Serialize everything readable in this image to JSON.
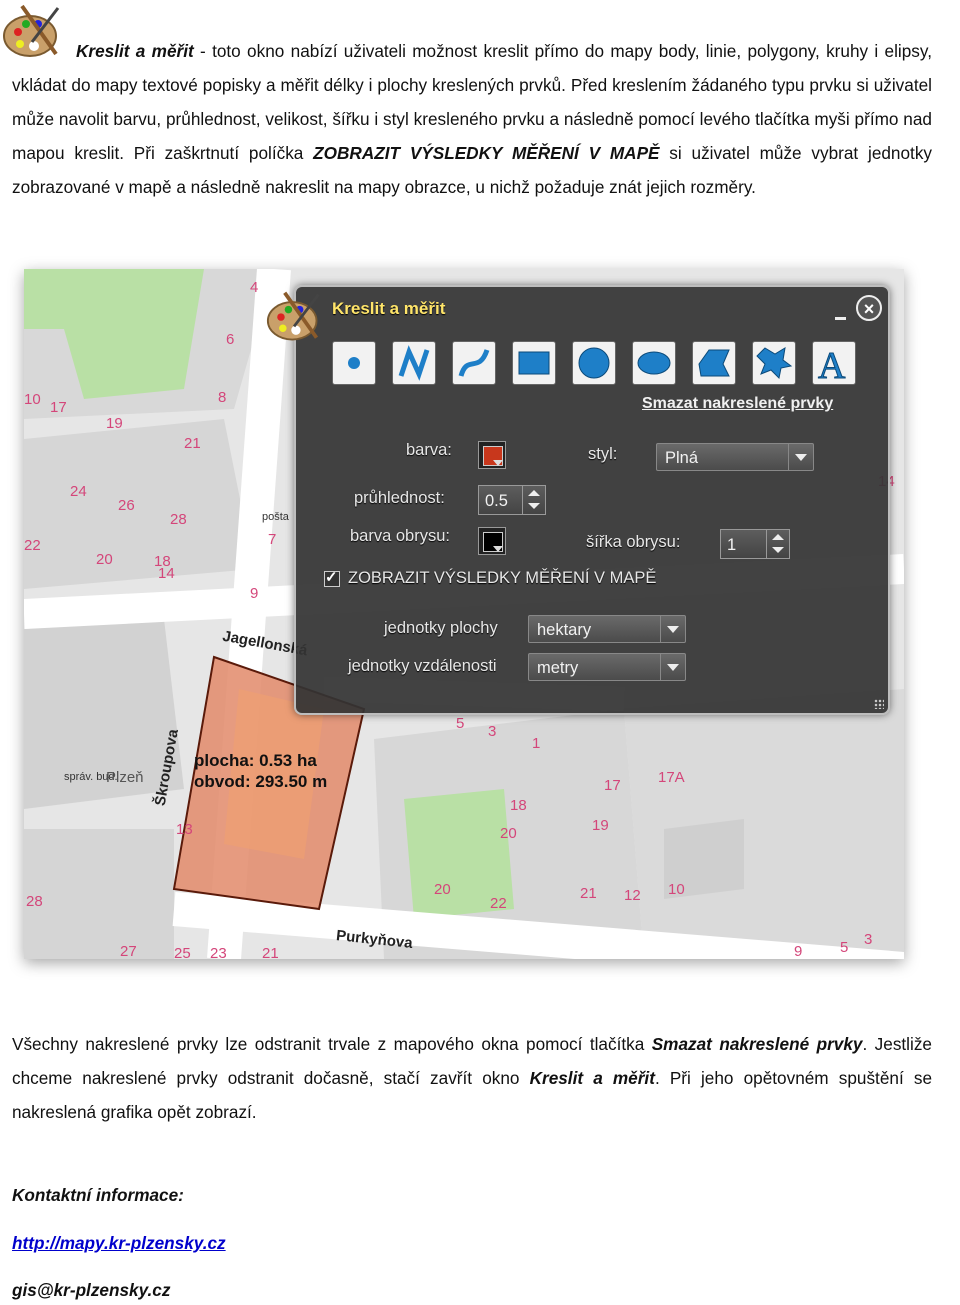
{
  "intro": {
    "title": "Kreslit a měřit",
    "part1": " - toto okno nabízí uživateli možnost kreslit přímo do mapy body, linie, polygony, kruhy i elipsy, vkládat do mapy textové popisky a měřit délky i plochy kreslených prvků. Před kreslením žádaného typu prvku si uživatel může navolit barvu, průhlednost, velikost, šířku i styl kresleného prvku a následně pomocí levého tlačítka myši přímo nad mapou kreslit. Při zaškrtnutí políčka ",
    "emph": "ZOBRAZIT VÝSLEDKY MĚŘENÍ V MAPĚ",
    "part2": " si uživatel může vybrat jednotky zobrazované v mapě a následně nakreslit na mapy obrazce, u nichž požaduje znát jejich rozměry."
  },
  "dialog": {
    "title": "Kreslit a měřit",
    "tools": [
      "point-tool-icon",
      "line-tool-icon",
      "curve-tool-icon",
      "rectangle-tool-icon",
      "circle-tool-icon",
      "ellipse-tool-icon",
      "polygon-tool-icon",
      "freehand-tool-icon",
      "text-tool-icon"
    ],
    "text_tool_glyph": "A",
    "clear_label": "Smazat nakreslené prvky",
    "color_label": "barva:",
    "color_value": "#c8371c",
    "style_label": "styl:",
    "style_value": "Plná",
    "opacity_label": "průhlednost:",
    "opacity_value": "0.5",
    "outline_color_label": "barva obrysu:",
    "outline_color_value": "#000000",
    "outline_width_label": "šířka obrysu:",
    "outline_width_value": "1",
    "show_results_label": "ZOBRAZIT VÝSLEDKY MĚŘENÍ V MAPĚ",
    "area_units_label": "jednotky plochy",
    "area_units_value": "hektary",
    "distance_units_label": "jednotky vzdálenosti",
    "distance_units_value": "metry"
  },
  "map": {
    "area_text": "plocha: 0.53 ha",
    "perimeter_text": "obvod: 293.50 m",
    "streets": [
      "Jagellonská",
      "Škroupova",
      "Purkyňova"
    ],
    "misc": [
      "pošta",
      "správ. bud.",
      "Plzeň"
    ],
    "numbers": [
      "4",
      "6",
      "8",
      "10",
      "17",
      "19",
      "21",
      "24",
      "26",
      "28",
      "22",
      "20",
      "18",
      "14",
      "7",
      "9",
      "5",
      "3",
      "1",
      "18",
      "20",
      "22",
      "20",
      "17",
      "19",
      "17A",
      "21",
      "12",
      "10",
      "13",
      "28",
      "27",
      "25",
      "23",
      "21",
      "9",
      "5",
      "3",
      "14"
    ]
  },
  "outro": {
    "part1": "Všechny nakreslené prvky lze odstranit trvale z mapového okna pomocí tlačítka ",
    "btn": "Smazat nakreslené prvky",
    "part2": ". Jestliže chceme nakreslené prvky odstranit dočasně, stačí zavřít okno ",
    "window": "Kreslit a měřit",
    "part3": ". Při jeho opětovném spuštění se nakreslená grafika opět zobrazí."
  },
  "contact": {
    "heading": "Kontaktní informace:",
    "web": "http://mapy.kr-plzensky.cz",
    "email": "gis@kr-plzensky.cz"
  }
}
